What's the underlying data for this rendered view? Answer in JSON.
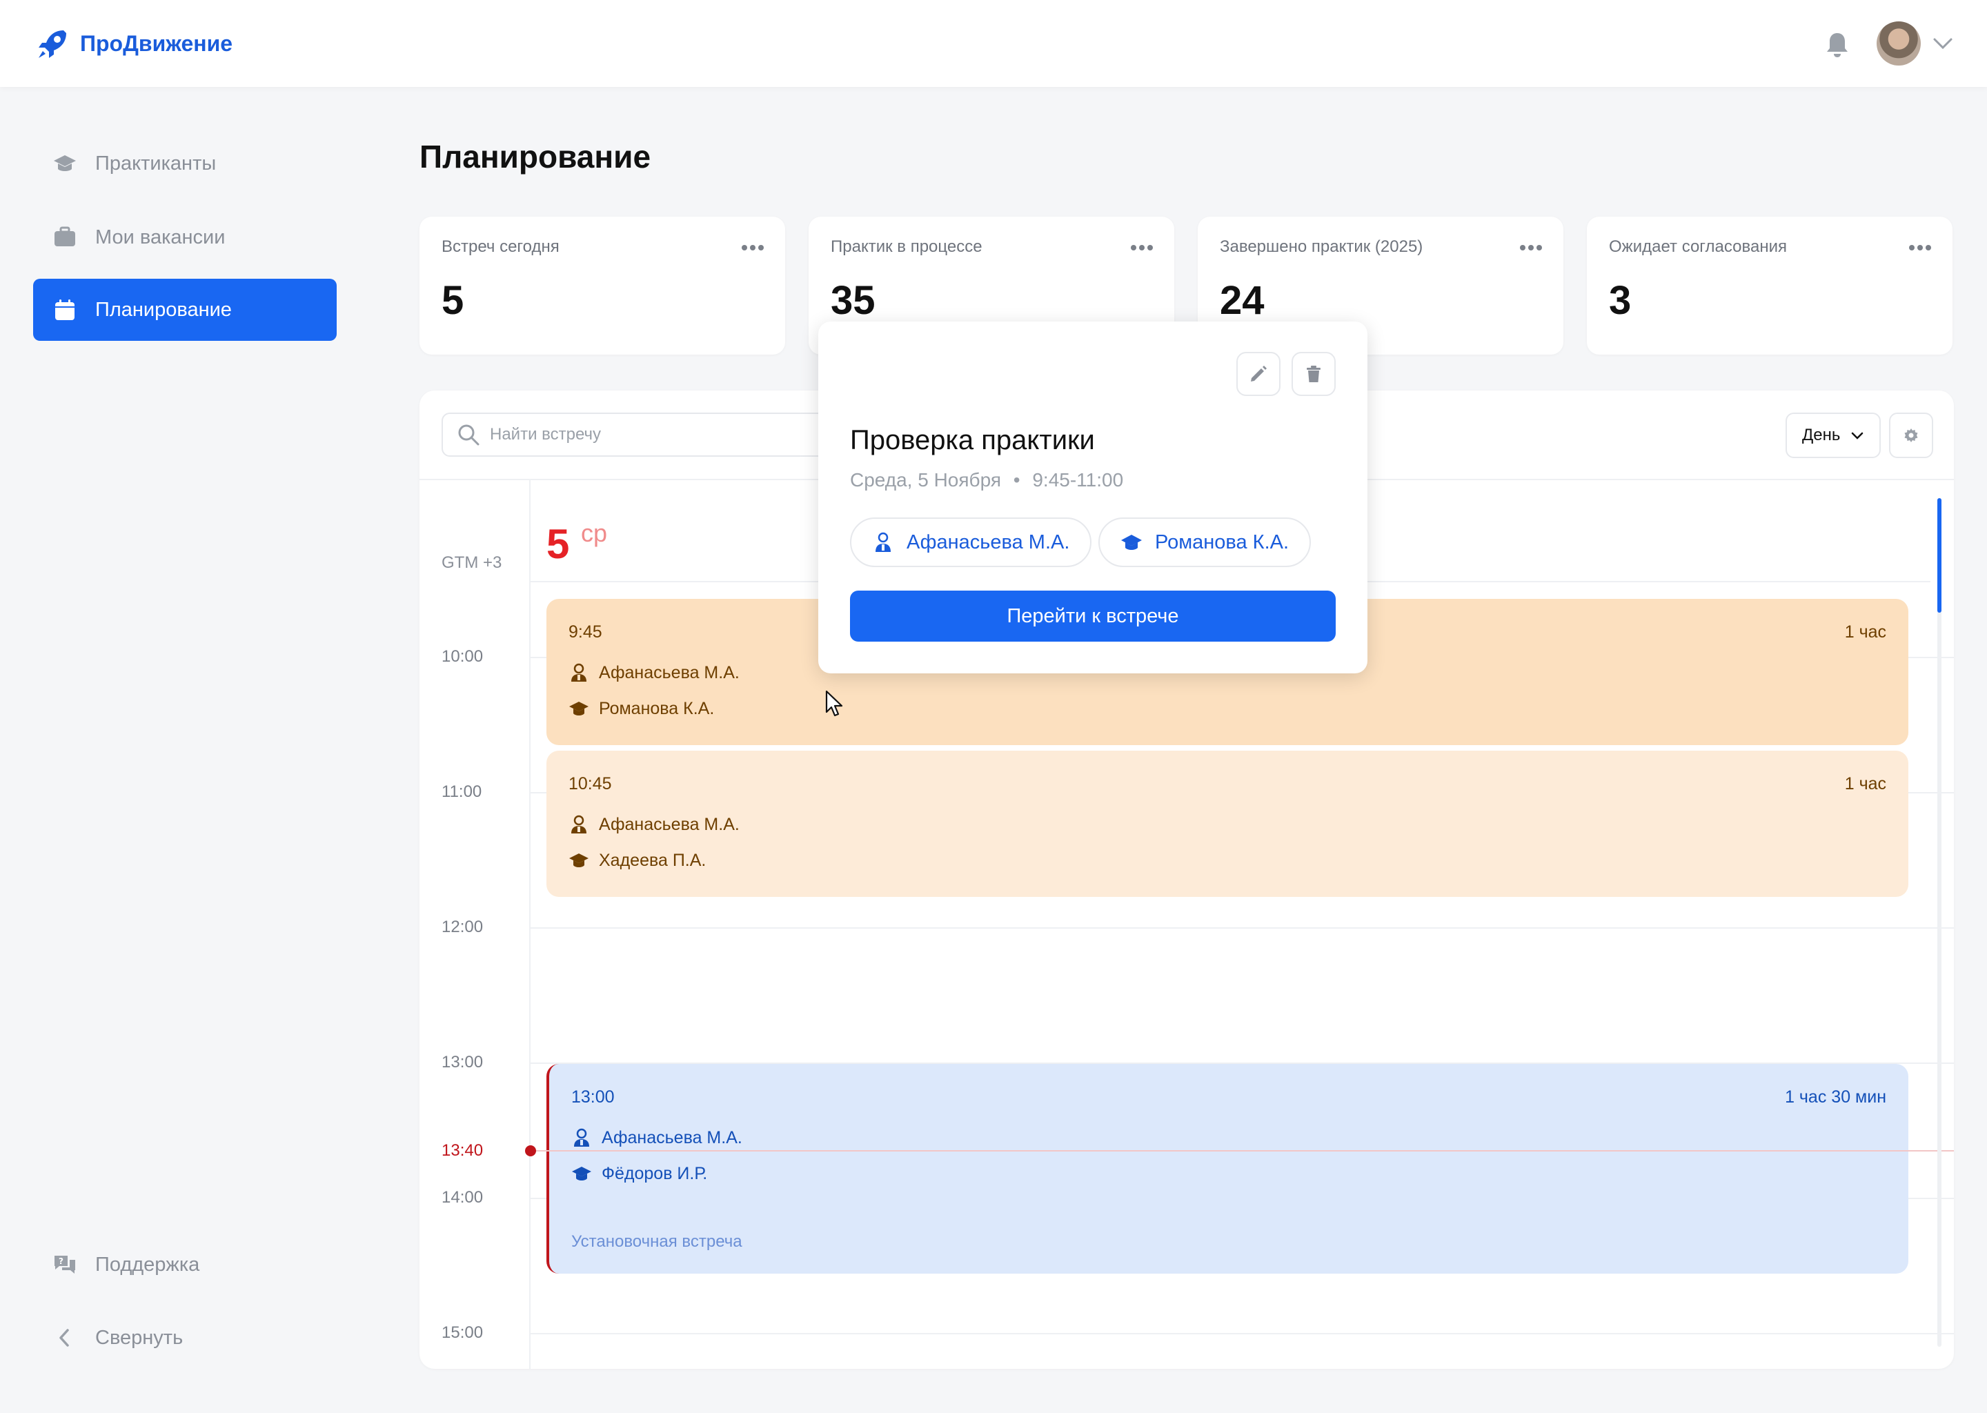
{
  "app": {
    "name": "ПроДвижение"
  },
  "sidebar": {
    "items": [
      {
        "label": "Практиканты",
        "icon": "graduation-cap-icon",
        "active": false
      },
      {
        "label": "Мои вакансии",
        "icon": "briefcase-icon",
        "active": false
      },
      {
        "label": "Планирование",
        "icon": "calendar-icon",
        "active": true
      }
    ],
    "support_label": "Поддержка",
    "collapse_label": "Свернуть"
  },
  "page": {
    "title": "Планирование"
  },
  "stats": [
    {
      "label": "Встреч сегодня",
      "value": "5"
    },
    {
      "label": "Практик в процессе",
      "value": "35"
    },
    {
      "label": "Завершено практик (2025)",
      "value": "24"
    },
    {
      "label": "Ожидает согласования",
      "value": "3"
    }
  ],
  "calendar": {
    "search_placeholder": "Найти встречу",
    "view_mode": "День",
    "day_number": "5",
    "day_name": "ср",
    "timezone": "GTM +3",
    "hours": [
      "10:00",
      "11:00",
      "12:00",
      "13:00",
      "14:00",
      "15:00"
    ],
    "current_time": "13:40",
    "events": [
      {
        "time": "9:45",
        "duration": "1 час",
        "mentor": "Афанасьева М.А.",
        "student": "Романова К.А.",
        "note": ""
      },
      {
        "time": "10:45",
        "duration": "1 час",
        "mentor": "Афанасьева М.А.",
        "student": "Хадеева П.А.",
        "note": ""
      },
      {
        "time": "13:00",
        "duration": "1 час 30 мин",
        "mentor": "Афанасьева М.А.",
        "student": "Фёдоров И.Р.",
        "note": "Установочная встреча"
      }
    ]
  },
  "popover": {
    "title": "Проверка практики",
    "date": "Среда, 5 Ноября",
    "time_range": "9:45-11:00",
    "mentor": "Афанасьева М.А.",
    "student": "Романова К.А.",
    "cta_label": "Перейти к встрече"
  },
  "colors": {
    "accent": "#1967F2",
    "brand": "#1A5CDB",
    "today": "#E52226",
    "now_line": "#C0151B",
    "event_orange": "#FCE0BF",
    "event_orange_light": "#FDEBD8",
    "event_blue": "#DCE8FB"
  }
}
